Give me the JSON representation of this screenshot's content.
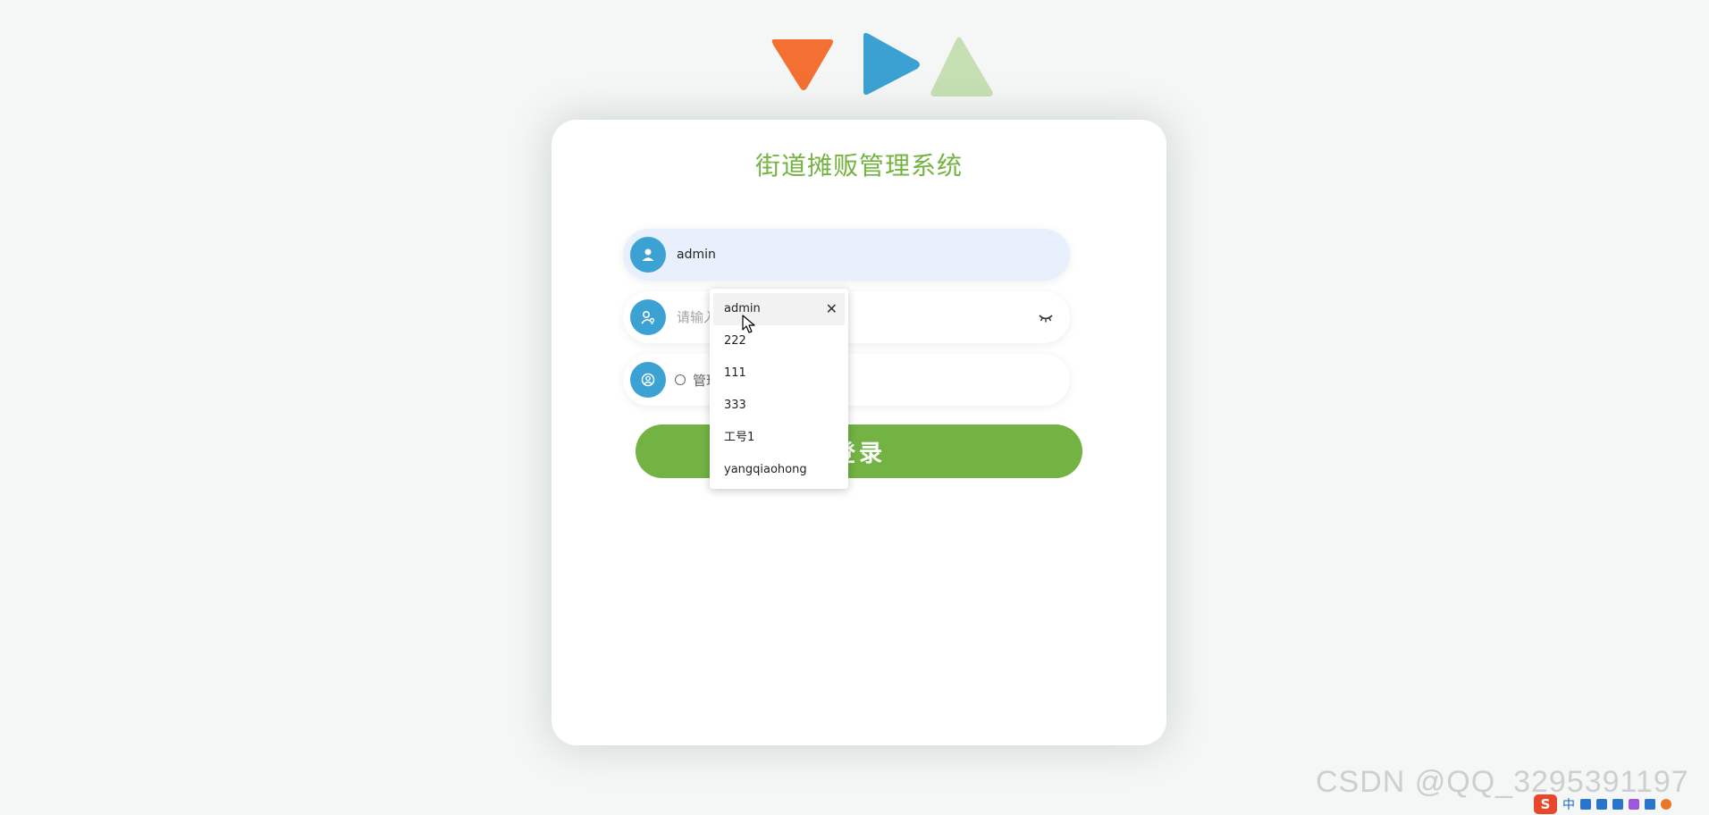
{
  "app": {
    "title": "街道摊贩管理系统"
  },
  "login_form": {
    "username_value": "admin",
    "password_placeholder": "请输入密码",
    "role_options": [
      "管理员",
      "员"
    ],
    "login_label": "登录"
  },
  "autocomplete": {
    "items": [
      "admin",
      "222",
      "111",
      "333",
      "工号1",
      "yangqiaohong"
    ],
    "active_index": 0,
    "remove_symbol": "✕"
  },
  "watermark": {
    "text": "CSDN @QQ_3295391197"
  },
  "tray": {
    "app_letter": "S",
    "ime_label": "中"
  },
  "colors": {
    "accent_green": "#72b343",
    "title_green": "#73b33f",
    "icon_blue": "#3ba2d3",
    "logo_orange": "#f36f32",
    "logo_blue": "#3aa1d2",
    "logo_light_green": "#c6dfb3"
  },
  "icons": {
    "logo": "triangles-logo-icon",
    "username": "user-icon",
    "password": "user-key-icon",
    "role": "user-circle-icon",
    "eye": "eye-closed-icon",
    "cursor": "mouse-cursor-icon"
  }
}
